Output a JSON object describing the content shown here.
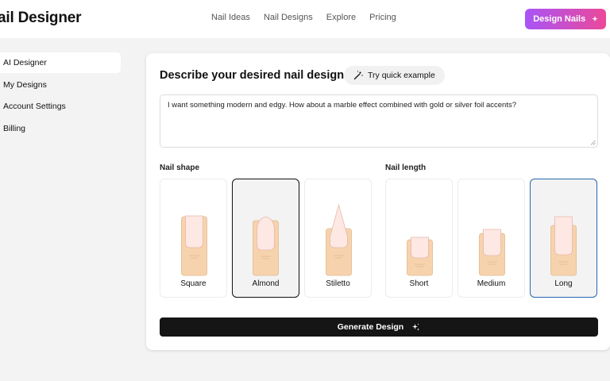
{
  "header": {
    "brand": "ail Designer",
    "nav": [
      "Nail Ideas",
      "Nail Designs",
      "Explore",
      "Pricing"
    ],
    "cta_label": "Design Nails",
    "cta_icon": "sparkle-icon"
  },
  "sidebar": {
    "items": [
      {
        "label": "AI Designer",
        "active": true
      },
      {
        "label": "My Designs",
        "active": false
      },
      {
        "label": "Account Settings",
        "active": false
      },
      {
        "label": "Billing",
        "active": false
      }
    ]
  },
  "main": {
    "title": "Describe your desired nail design",
    "quick_example_label": "Try quick example",
    "prompt_text": "I want something modern and edgy. How about a marble effect combined with gold or silver foil accents?",
    "shape_label": "Nail shape",
    "length_label": "Nail length",
    "shapes": [
      {
        "label": "Square",
        "selected": false
      },
      {
        "label": "Almond",
        "selected": true
      },
      {
        "label": "Stiletto",
        "selected": false
      }
    ],
    "lengths": [
      {
        "label": "Short",
        "selected": false
      },
      {
        "label": "Medium",
        "selected": false
      },
      {
        "label": "Long",
        "selected": true
      }
    ],
    "generate_label": "Generate Design"
  },
  "colors": {
    "accent_gradient_start": "#a855f7",
    "accent_gradient_end": "#ec4899",
    "finger": "#f7d3ad",
    "nail": "#fde8e3",
    "selected_shape_border": "#111111",
    "selected_length_border": "#2767b0"
  }
}
